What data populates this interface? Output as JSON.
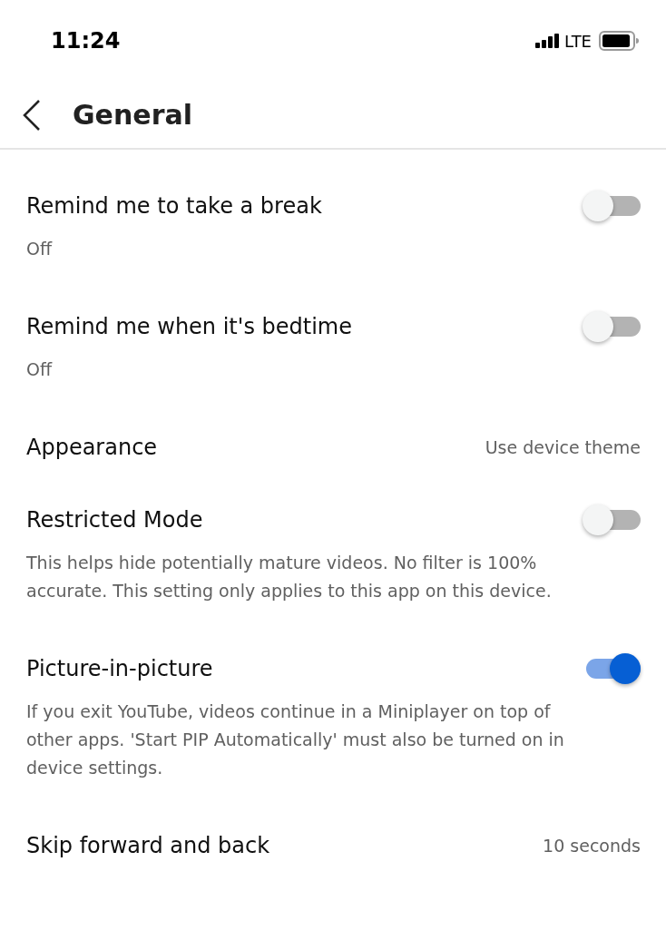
{
  "status_bar": {
    "time": "11:24",
    "network": "LTE"
  },
  "header": {
    "title": "General"
  },
  "settings": [
    {
      "kind": "toggle",
      "title": "Remind me to take a break",
      "on": false,
      "subtitle": "Off"
    },
    {
      "kind": "toggle",
      "title": "Remind me when it's bedtime",
      "on": false,
      "subtitle": "Off"
    },
    {
      "kind": "value",
      "title": "Appearance",
      "value": "Use device theme"
    },
    {
      "kind": "toggle",
      "title": "Restricted Mode",
      "on": false,
      "subtitle": "This helps hide potentially mature videos. No filter is 100% accurate. This setting only applies to this app on this device."
    },
    {
      "kind": "toggle",
      "title": "Picture-in-picture",
      "on": true,
      "subtitle": "If you exit YouTube, videos continue in a Miniplayer on top of other apps. 'Start PIP Automatically' must also be turned on in device settings."
    },
    {
      "kind": "value",
      "title": "Skip forward and back",
      "value": "10 seconds"
    }
  ]
}
